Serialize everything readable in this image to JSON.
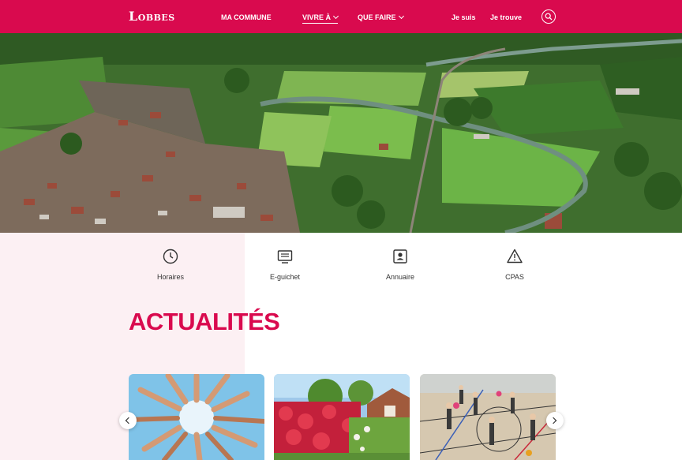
{
  "header": {
    "logo": "Lobbes",
    "nav": [
      {
        "label": "MA COMMUNE"
      },
      {
        "label": "VIVRE À"
      },
      {
        "label": "QUE FAIRE"
      }
    ],
    "utilities": [
      {
        "label": "Je suis"
      },
      {
        "label": "Je trouve"
      }
    ],
    "search_icon": "search-icon"
  },
  "quick_links": [
    {
      "label": "Horaires",
      "icon": "clock-icon"
    },
    {
      "label": "E-guichet",
      "icon": "monitor-icon"
    },
    {
      "label": "Annuaire",
      "icon": "contact-card-icon"
    },
    {
      "label": "CPAS",
      "icon": "warning-icon"
    }
  ],
  "news": {
    "title": "ACTUALITÉS"
  },
  "colors": {
    "brand": "#d90a4e",
    "pink_band": "#fcf0f3"
  }
}
